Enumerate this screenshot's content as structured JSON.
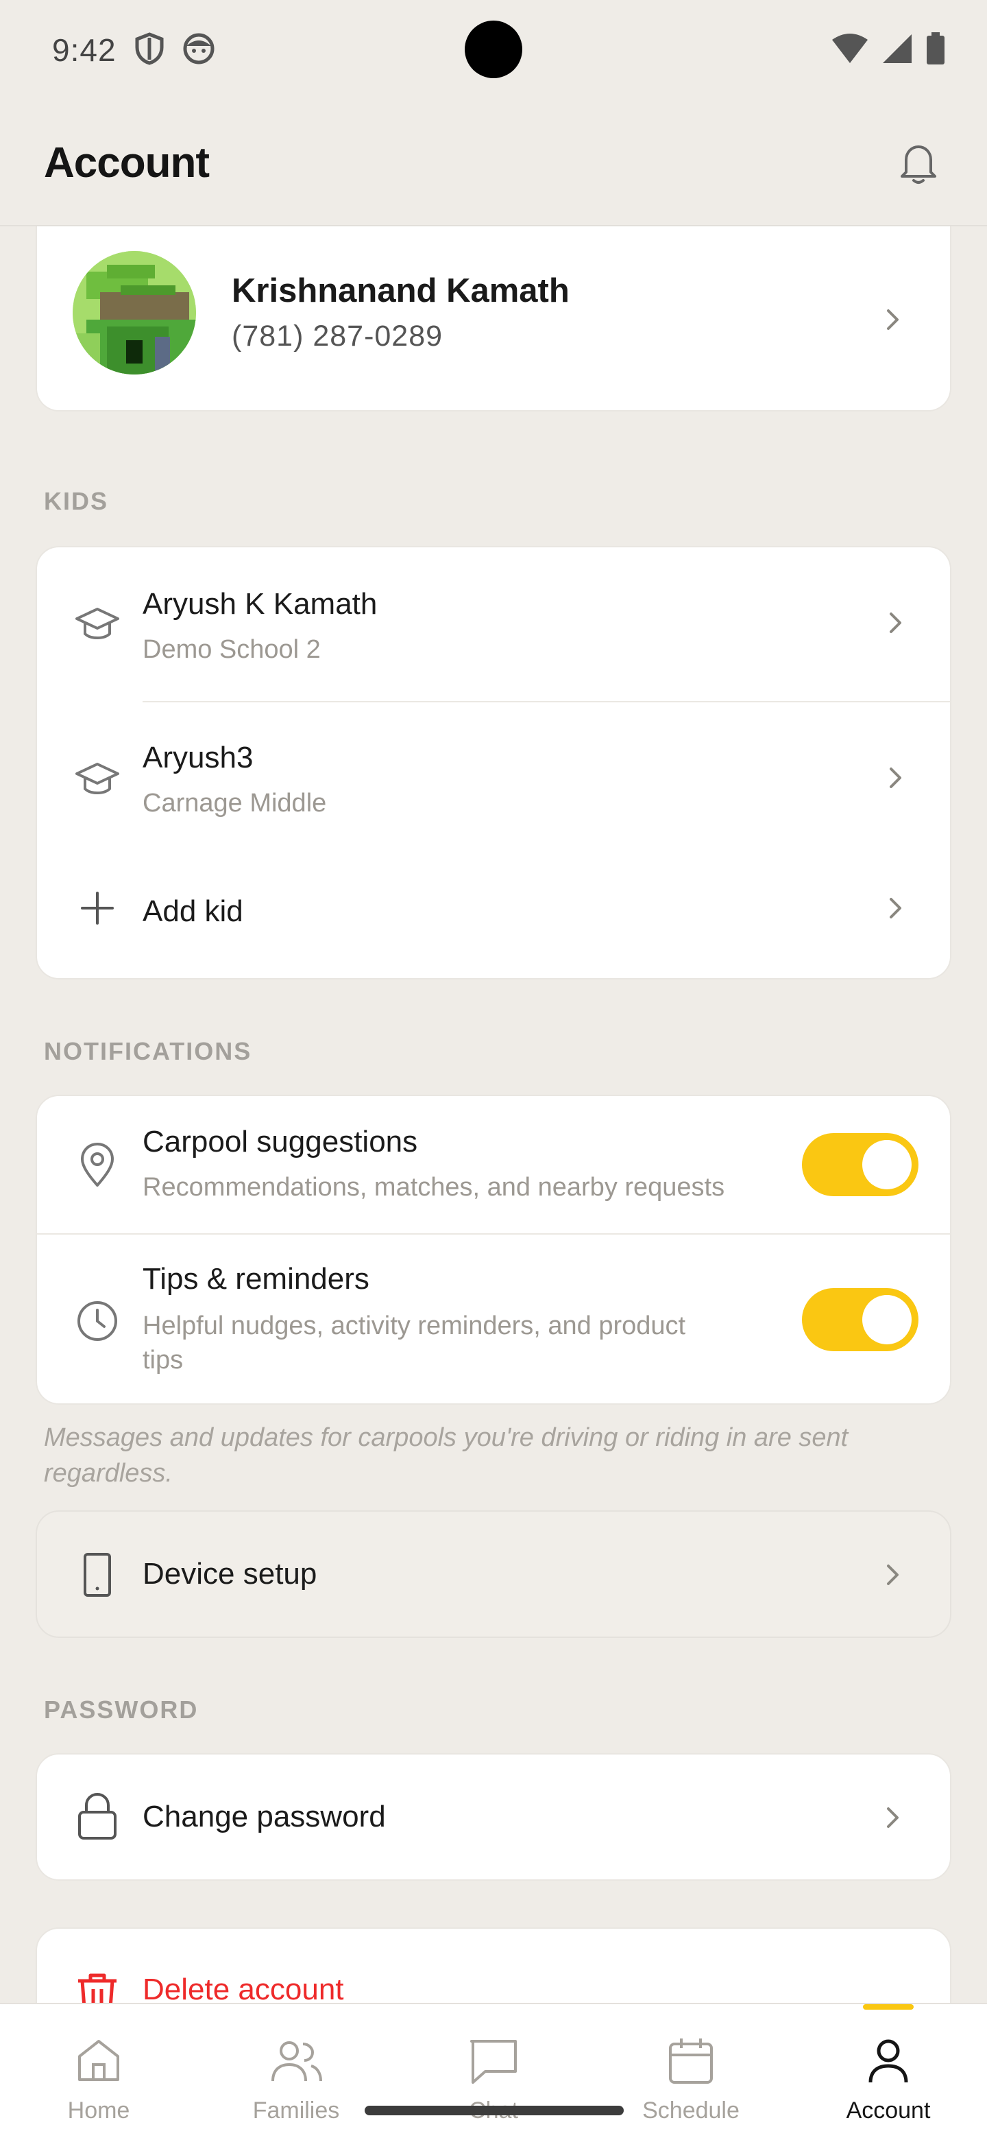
{
  "status_bar": {
    "time": "9:42"
  },
  "header": {
    "title": "Account"
  },
  "profile": {
    "name": "Krishnanand Kamath",
    "phone": "(781) 287-0289"
  },
  "kids": {
    "section_label": "KIDS",
    "items": [
      {
        "name": "Aryush K Kamath",
        "school": "Demo School 2"
      },
      {
        "name": "Aryush3",
        "school": "Carnage Middle"
      }
    ],
    "add_label": "Add kid"
  },
  "notifications": {
    "section_label": "NOTIFICATIONS",
    "items": [
      {
        "title": "Carpool suggestions",
        "subtitle": "Recommendations, matches, and nearby requests",
        "enabled": true
      },
      {
        "title": "Tips & reminders",
        "subtitle_line1": "Helpful nudges, activity reminders, and product",
        "subtitle_line2": "tips",
        "enabled": true
      }
    ],
    "footnote": "Messages and updates for carpools you're driving or riding in are sent regardless."
  },
  "device_setup": {
    "label": "Device setup"
  },
  "password": {
    "section_label": "PASSWORD",
    "change_label": "Change password"
  },
  "delete": {
    "label": "Delete account"
  },
  "nav": {
    "items": [
      {
        "label": "Home",
        "icon": "home-icon"
      },
      {
        "label": "Families",
        "icon": "families-icon"
      },
      {
        "label": "Chat",
        "icon": "chat-icon"
      },
      {
        "label": "Schedule",
        "icon": "calendar-icon"
      },
      {
        "label": "Account",
        "icon": "account-icon",
        "active": true
      }
    ]
  },
  "colors": {
    "accent": "#fac712",
    "danger": "#ee2a2a",
    "background": "#efece7"
  }
}
